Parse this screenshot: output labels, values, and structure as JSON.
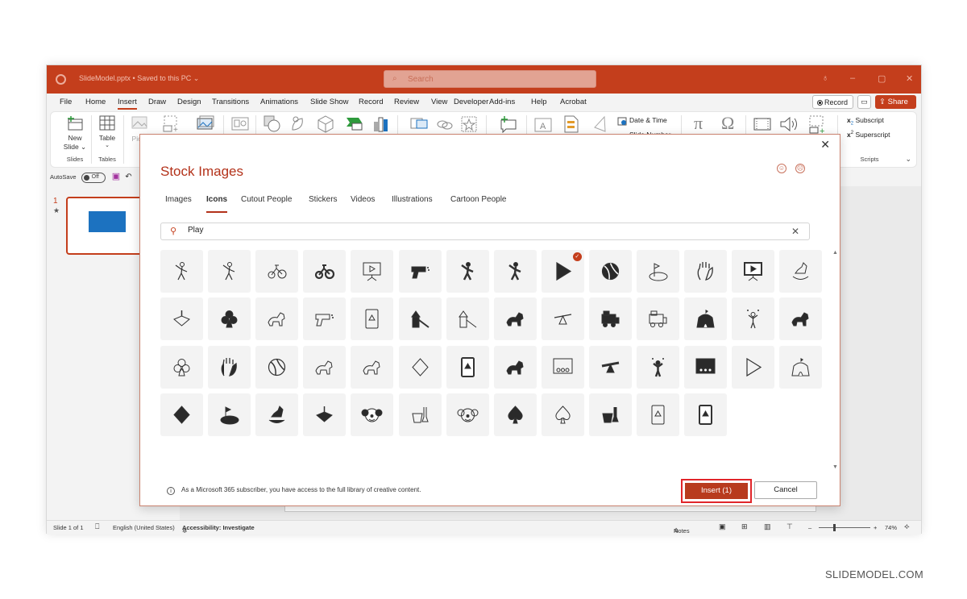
{
  "titlebar": {
    "document": "SlideModel.pptx • Saved to this PC ⌄",
    "search_placeholder": "Search",
    "controls": [
      "lightbulb",
      "minimize",
      "maximize",
      "close"
    ]
  },
  "menu": {
    "items": [
      "File",
      "Home",
      "Insert",
      "Draw",
      "Design",
      "Transitions",
      "Animations",
      "Slide Show",
      "Record",
      "Review",
      "View",
      "Developer",
      "Add-ins",
      "Help",
      "Acrobat"
    ],
    "active": "Insert",
    "record_label": "Record",
    "share_label": "Share"
  },
  "ribbon": {
    "new_slide": "New Slide ⌄",
    "table": "Table",
    "pictures": "Pictu",
    "slides_group": "Slides",
    "tables_group": "Tables",
    "date_time": "Date & Time",
    "slide_number": "Slide Number",
    "subscript": "Subscript",
    "superscript": "Superscript",
    "scripts_group": "Scripts"
  },
  "qat": {
    "autosave": "AutoSave",
    "autosave_state": "Off"
  },
  "thumbnails": {
    "slide_number": "1"
  },
  "statusbar": {
    "slide": "Slide 1 of 1",
    "language": "English (United States)",
    "accessibility": "Accessibility: Investigate",
    "notes": "Notes",
    "zoom": "74%"
  },
  "dialog": {
    "title": "Stock Images",
    "tabs": [
      "Images",
      "Icons",
      "Cutout People",
      "Stickers",
      "Videos",
      "Illustrations",
      "Cartoon People"
    ],
    "active_tab": "Icons",
    "search_value": "Play",
    "icons": [
      "baseball-batter-outline",
      "cricket-player-outline",
      "tricycle-outline",
      "tricycle-filled",
      "presentation-play-outline",
      "water-gun-filled",
      "cricket-player-filled",
      "baseball-batter-filled",
      "play-filled",
      "beach-ball-filled",
      "golf-outline",
      "hand-paint-outline",
      "presentation-play-filled",
      "rocking-horse-outline",
      "spinning-top-outline",
      "club-filled",
      "puppy-outline",
      "water-gun-outline",
      "joker-card-outline",
      "playground-filled",
      "playground-outline",
      "dog-filled",
      "seesaw-outline",
      "toy-train-filled",
      "toy-train-outline",
      "circus-tent-filled",
      "juggler-outline",
      "puppy-filled",
      "club-outline",
      "hand-paint-filled",
      "beach-ball-outline",
      "cat-outline",
      "dog-outline",
      "diamond-outline",
      "joker-card-filled",
      "cat-filled",
      "theater-outline",
      "seesaw-filled",
      "juggler-filled",
      "theater-filled",
      "play-outline",
      "circus-tent-outline",
      "diamond-filled",
      "golf-filled",
      "rocking-horse-filled",
      "spinning-top-filled",
      "clown-filled",
      "sand-bucket-outline",
      "clown-outline",
      "spade-filled",
      "spade-outline",
      "sand-bucket-filled",
      "club-card-outline",
      "club-card-filled"
    ],
    "selected_icon": "play-filled",
    "note": "As a Microsoft 365 subscriber, you have access to the full library of creative content.",
    "insert_label": "Insert (1)",
    "cancel_label": "Cancel"
  },
  "watermark": "SLIDEMODEL.COM",
  "colors": {
    "accent": "#c43e1c",
    "dialog_title": "#b3321a",
    "insert_button": "#b83b1e",
    "slide_blue": "#1c72c0"
  }
}
